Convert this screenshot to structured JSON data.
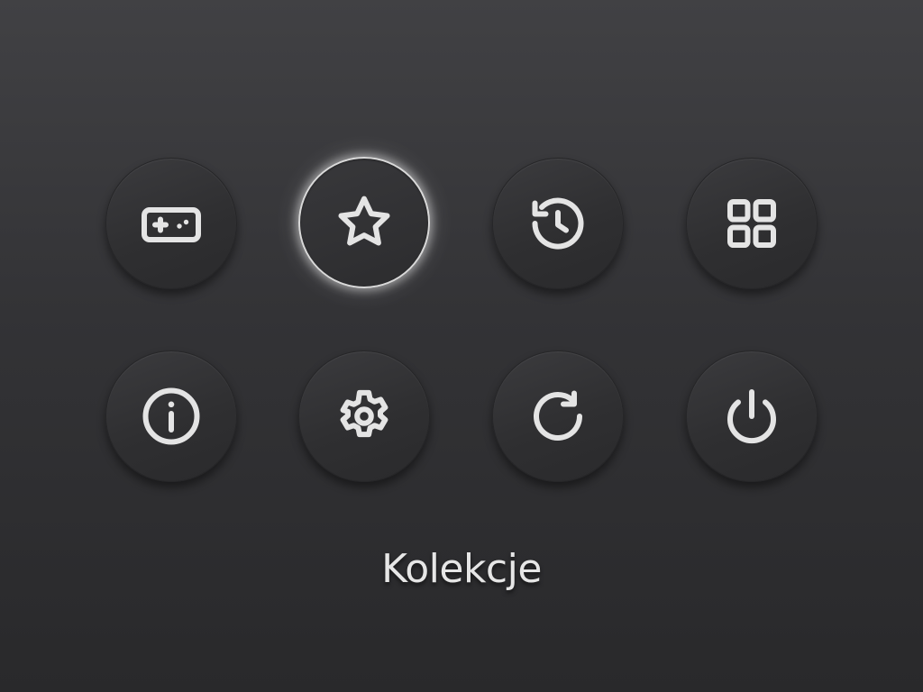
{
  "menu": {
    "selected_label": "Kolekcje",
    "items": [
      {
        "icon": "gamepad-icon",
        "selected": false
      },
      {
        "icon": "star-icon",
        "selected": true
      },
      {
        "icon": "history-icon",
        "selected": false
      },
      {
        "icon": "grid-icon",
        "selected": false
      },
      {
        "icon": "info-icon",
        "selected": false
      },
      {
        "icon": "gear-icon",
        "selected": false
      },
      {
        "icon": "refresh-icon",
        "selected": false
      },
      {
        "icon": "power-icon",
        "selected": false
      }
    ]
  },
  "colors": {
    "icon_stroke": "#e4e4e4",
    "selection_ring": "#d9d9d9",
    "background_top": "#414144",
    "background_bottom": "#29292b"
  }
}
